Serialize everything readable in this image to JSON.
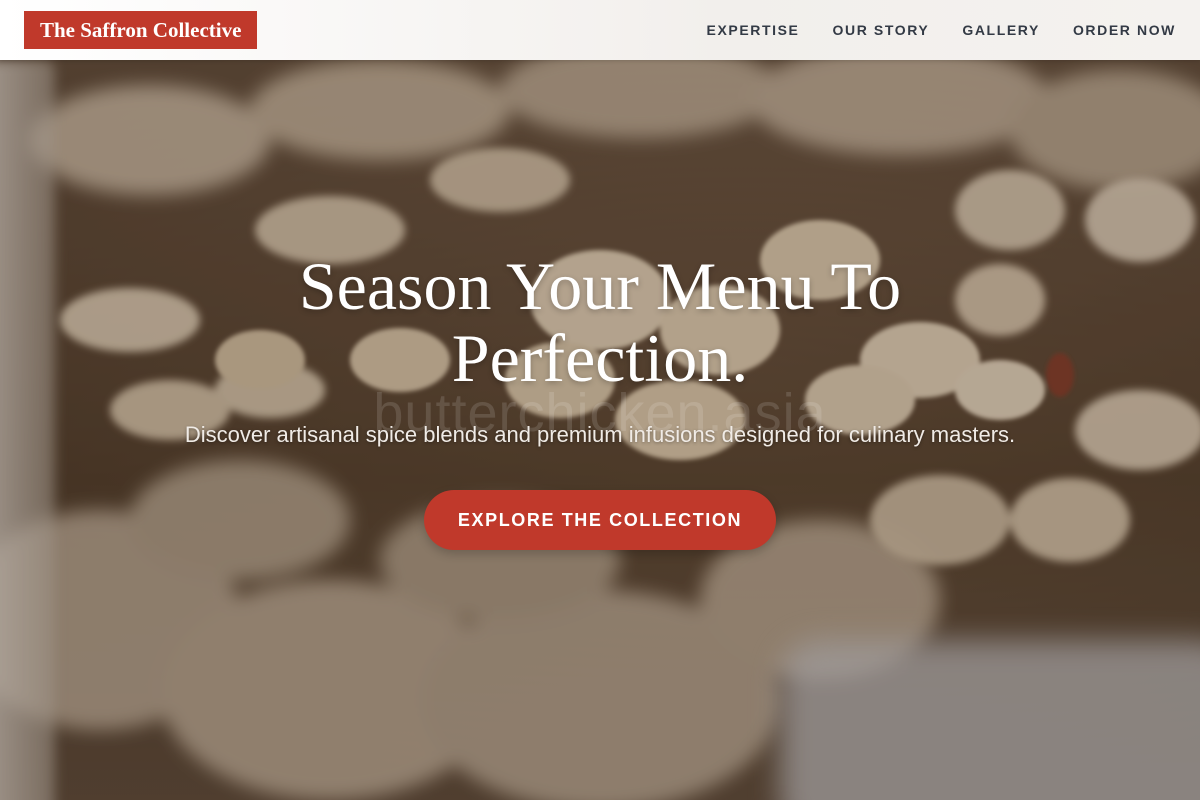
{
  "header": {
    "brand": "The Saffron Collective",
    "nav": [
      {
        "label": "EXPERTISE"
      },
      {
        "label": "OUR STORY"
      },
      {
        "label": "GALLERY"
      },
      {
        "label": "ORDER NOW"
      }
    ]
  },
  "hero": {
    "title": "Season Your Menu To Perfection.",
    "watermark": "butterchicken.asia",
    "subtitle": "Discover artisanal spice blends and premium infusions designed for culinary masters.",
    "cta_label": "EXPLORE THE COLLECTION",
    "background": "blurred-peanuts-photo"
  },
  "colors": {
    "accent": "#c0392b",
    "nav_text": "#333a45",
    "header_bg": "#f4f2ef",
    "hero_text": "#ffffff"
  }
}
